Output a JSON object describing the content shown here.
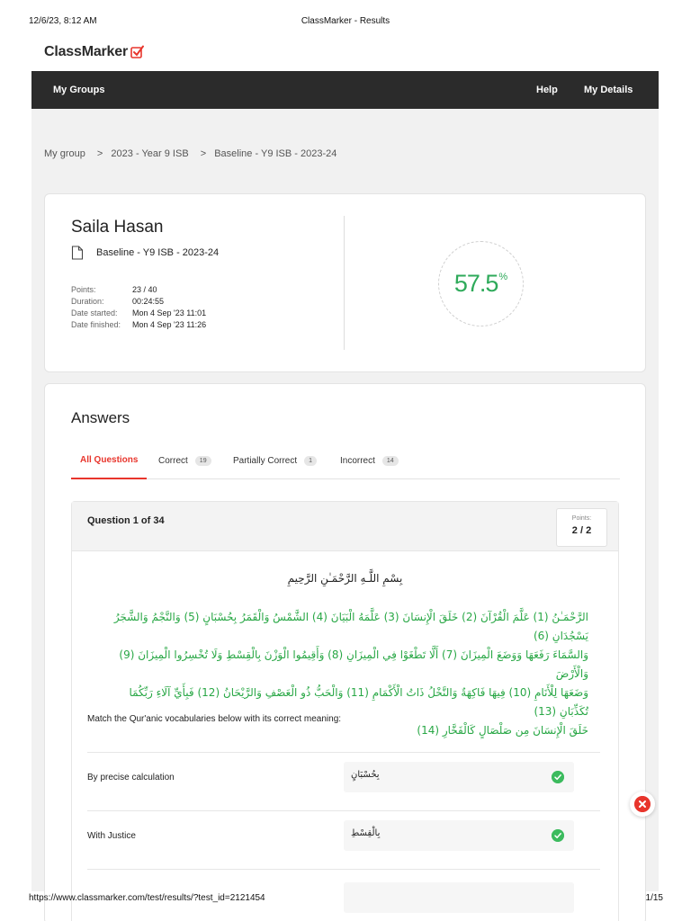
{
  "print_header": {
    "datetime": "12/6/23, 8:12 AM",
    "page_title": "ClassMarker - Results"
  },
  "print_footer": {
    "url": "https://www.classmarker.com/test/results/?test_id=2121454",
    "page": "1/15"
  },
  "brand": {
    "name": "ClassMarker",
    "accent": "#e8352c"
  },
  "nav": {
    "left": "My Groups",
    "help": "Help",
    "details": "My Details"
  },
  "breadcrumb": [
    "My group",
    "2023 - Year 9 ISB",
    "Baseline - Y9 ISB - 2023-24"
  ],
  "breadcrumb_sep": ">",
  "result": {
    "student": "Saila Hasan",
    "test_name": "Baseline - Y9 ISB - 2023-24",
    "meta": [
      {
        "label": "Points:",
        "value": "23 / 40"
      },
      {
        "label": "Duration:",
        "value": "00:24:55"
      },
      {
        "label": "Date started:",
        "value": "Mon 4 Sep '23 11:01"
      },
      {
        "label": "Date finished:",
        "value": "Mon 4 Sep '23 11:26"
      }
    ],
    "score": "57.5",
    "score_unit": "%"
  },
  "answers": {
    "title": "Answers",
    "tabs": [
      {
        "label": "All Questions"
      },
      {
        "label": "Correct",
        "count": "19"
      },
      {
        "label": "Partially Correct",
        "count": "1"
      },
      {
        "label": "Incorrect",
        "count": "14"
      }
    ]
  },
  "question": {
    "title": "Question 1 of 34",
    "points_label": "Points:",
    "points_value": "2 / 2",
    "arabic_title": "بِسْمِ اللَّـهِ الرَّحْمَـٰنِ الرَّحِيمِ",
    "arabic_lines": [
      "الرَّحْمَـٰنُ (1) عَلَّمَ الْقُرْآنَ (2) خَلَقَ الْإِنسَانَ (3) عَلَّمَهُ الْبَيَانَ (4) الشَّمْسُ وَالْقَمَرُ بِحُسْبَانٍ (5) وَالنَّجْمُ وَالشَّجَرُ يَسْجُدَانِ (6)",
      "وَالسَّمَاءَ رَفَعَهَا وَوَضَعَ الْمِيزَانَ (7) أَلَّا تَطْغَوْا فِي الْمِيزَانِ (8) وَأَقِيمُوا الْوَزْنَ بِالْقِسْطِ وَلَا تُخْسِرُوا الْمِيزَانَ (9) وَالْأَرْضَ",
      "وَضَعَهَا لِلْأَنَامِ (10) فِيهَا فَاكِهَةٌ وَالنَّخْلُ ذَاتُ الْأَكْمَامِ (11) وَالْحَبُّ ذُو الْعَصْفِ وَالرَّيْحَانُ (12) فَبِأَيِّ آلَاءِ رَبِّكُمَا تُكَذِّبَانِ (13)",
      "خَلَقَ الْإِنسَانَ مِن صَلْصَالٍ كَالْفَخَّارِ (14)"
    ],
    "instruction": "Match the Qur'anic vocabularies below with its correct meaning:",
    "matches": [
      {
        "prompt": "By precise calculation",
        "answer": "بِحُسْبَانٍ"
      },
      {
        "prompt": "With Justice",
        "answer": "بِالْقِسْطِ"
      }
    ]
  },
  "colors": {
    "correct": "#3cbb5e",
    "incorrect": "#e8352c",
    "arabic_text": "#28a745"
  }
}
